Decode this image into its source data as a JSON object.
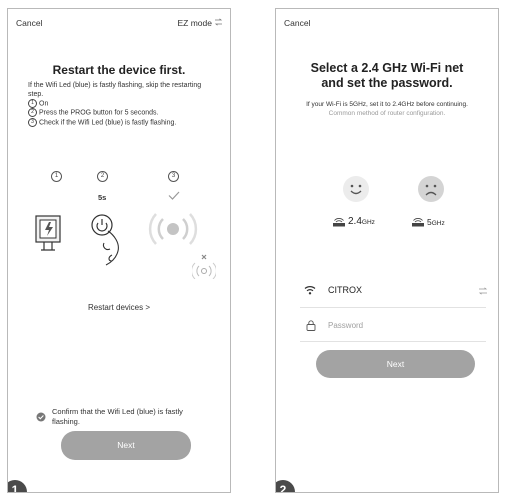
{
  "screen1": {
    "cancel": "Cancel",
    "mode": "EZ mode",
    "title": "Restart the device first.",
    "intro": "If the Wifi Led (blue) is fastly flashing, skip the restarting step.",
    "steps": [
      {
        "num": "1",
        "text": "On"
      },
      {
        "num": "2",
        "text": "Press the PROG button for 5 seconds."
      },
      {
        "num": "3",
        "text": "Check if the Wifi Led (blue) is fastly flashing."
      }
    ],
    "step_labels": [
      "1",
      "2",
      "3"
    ],
    "timer": "5s",
    "restart_link": "Restart devices >",
    "confirm": "Confirm that the Wifi Led (blue) is fastly flashing.",
    "next": "Next",
    "badge": "1"
  },
  "screen2": {
    "cancel": "Cancel",
    "title": "Select a 2.4 GHz Wi-Fi net and set the password.",
    "note": "If your Wi-Fi is 5GHz, set it to 2.4GHz before continuing.",
    "note_link": "Common method of router configuration.",
    "band_good": "2.4",
    "band_good_unit": "GHz",
    "band_bad": "5",
    "band_bad_unit": "GHz",
    "ssid": "CITROX",
    "password_placeholder": "Password",
    "next": "Next",
    "badge": "2"
  }
}
